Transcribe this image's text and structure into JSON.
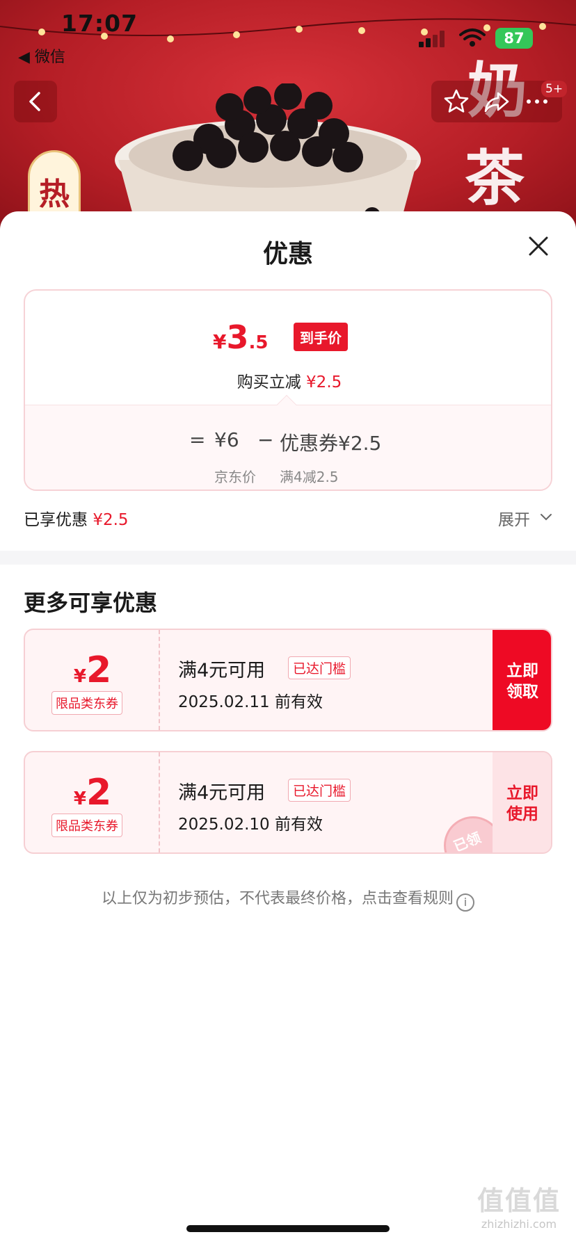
{
  "status_bar": {
    "time": "17:07",
    "back_app": "◀ 微信",
    "battery": "87"
  },
  "hero": {
    "banner_text_1": "奶",
    "banner_text_2": "茶",
    "side_badge": "热",
    "more_badge": "5+"
  },
  "sheet": {
    "title": "优惠",
    "price_card": {
      "currency": "¥",
      "price_int": "3",
      "price_dec": ".5",
      "final_tag": "到手价",
      "buy_reduce_label": "购买立减",
      "buy_reduce_value": "¥2.5",
      "eq_sign": "=",
      "jd_price": "¥6",
      "jd_price_label": "京东价",
      "minus_sign": "−",
      "coupon_label": "优惠券",
      "coupon_value": "¥2.5",
      "coupon_rule": "满4减2.5"
    },
    "enjoyed_label": "已享优惠",
    "enjoyed_value": "¥2.5",
    "expand_label": "展开"
  },
  "more": {
    "title": "更多可享优惠",
    "coupons": [
      {
        "currency": "¥",
        "amount": "2",
        "kind": "限品类东券",
        "condition": "满4元可用",
        "reached": "已达门槛",
        "valid_until": "2025.02.11 前有效",
        "action_line1": "立即",
        "action_line2": "领取"
      },
      {
        "currency": "¥",
        "amount": "2",
        "kind": "限品类东券",
        "condition": "满4元可用",
        "reached": "已达门槛",
        "valid_until": "2025.02.10 前有效",
        "action_line1": "立即",
        "action_line2": "使用",
        "stamp": "已领"
      }
    ]
  },
  "notice": "以上仅为初步预估，不代表最终价格，点击查看规则",
  "watermark": {
    "logo": "值值值",
    "site": "zhizhizhi.com"
  },
  "colors": {
    "accent": "#e8182b",
    "claim_bg": "#ee0a24",
    "hero_bg": "#b51e26"
  }
}
